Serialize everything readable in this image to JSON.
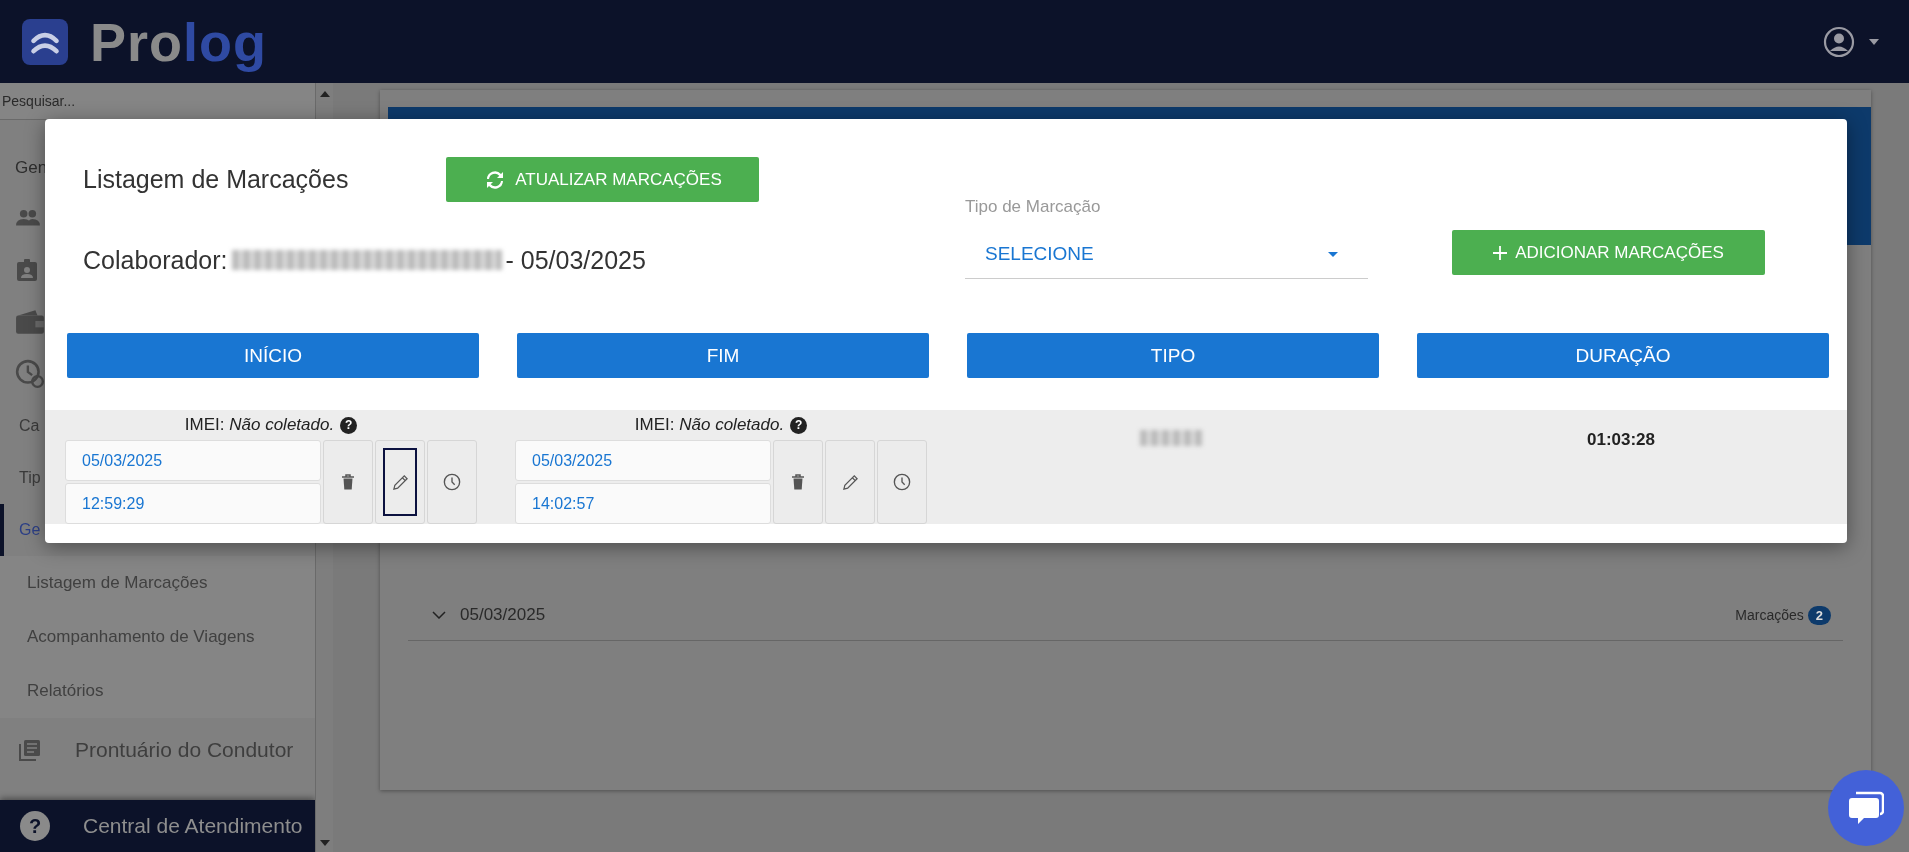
{
  "header": {
    "logo": {
      "part_1": "Pro",
      "part_2": "log"
    }
  },
  "sidebar": {
    "search": {
      "placeholder": "Pesquisar..."
    },
    "section_label": "Gen",
    "items": [
      {
        "kind": "people"
      },
      {
        "kind": "badge"
      },
      {
        "kind": "wallet"
      },
      {
        "kind": "clock"
      },
      {
        "kind": "text",
        "label": "Ca",
        "selected": false
      },
      {
        "kind": "text",
        "label": "Tip",
        "selected": false
      },
      {
        "kind": "text",
        "label": "Ge",
        "selected": true
      },
      {
        "kind": "subitem",
        "label": "Listagem de Marcações",
        "selected": false
      },
      {
        "kind": "subitem",
        "label": "Acompanhamento de Viagens",
        "selected": false
      },
      {
        "kind": "subitem",
        "label": "Relatórios",
        "selected": false
      },
      {
        "kind": "module",
        "label": "Prontuário do Condutor"
      }
    ],
    "footer": {
      "help_mark": "?",
      "label": "Central de Atendimento"
    }
  },
  "page": {
    "accordion": {
      "date": "05/03/2025",
      "count_label": "Marcações",
      "count": "2"
    }
  },
  "modal": {
    "title": "Listagem de Marcações",
    "refresh_button": "ATUALIZAR MARCAÇÕES",
    "collaborator": {
      "label": "Colaborador:",
      "date": "- 05/03/2025"
    },
    "type_select": {
      "label": "Tipo de Marcação",
      "value": "SELECIONE"
    },
    "add_button": "ADICIONAR MARCAÇÕES",
    "columns": [
      "INÍCIO",
      "FIM",
      "TIPO",
      "DURAÇÃO"
    ],
    "row": {
      "start": {
        "imei_label": "IMEI:",
        "imei_value": "Não coletado.",
        "help_mark": "?",
        "date": "05/03/2025",
        "time": "12:59:29",
        "edit_focused": true
      },
      "end": {
        "imei_label": "IMEI:",
        "imei_value": "Não coletado.",
        "help_mark": "?",
        "date": "05/03/2025",
        "time": "14:02:57",
        "edit_focused": false
      },
      "duration": "01:03:28"
    }
  }
}
